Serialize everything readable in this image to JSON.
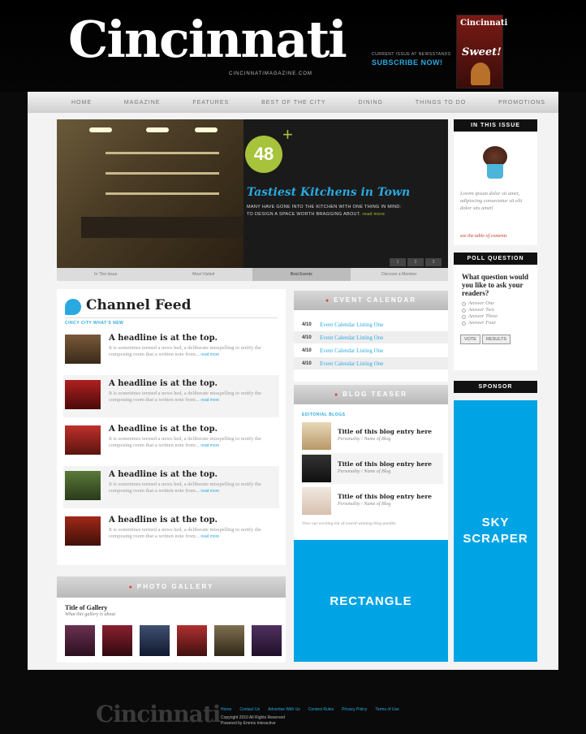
{
  "header": {
    "logo": "Cincinnati",
    "logo_sub": "CINCINNATIMAGAZINE.COM",
    "promo_small": "CURRENT ISSUE AT NEWSSTANDS",
    "promo_subscribe": "SUBSCRIBE NOW!",
    "cover_title": "Cincinnati",
    "cover_headline": "Sweet!"
  },
  "nav": [
    "HOME",
    "MAGAZINE",
    "FEATURES",
    "BEST OF THE CITY",
    "DINING",
    "THINGS TO DO",
    "PROMOTIONS"
  ],
  "hero": {
    "badge": "48",
    "plus": "+",
    "title": "Tastiest Kitchens in Town",
    "body": "MANY HAVE GONE INTO THE KITCHEN WITH ONE THING IN MIND: TO DESIGN A SPACE WORTH BRAGGING ABOUT.",
    "more": "read more",
    "pager": [
      "1",
      "2",
      "3"
    ],
    "tabs": [
      "In This Issue",
      "Most Visited",
      "Best Events",
      "Discover a Member"
    ]
  },
  "in_this_issue": {
    "heading": "IN THIS ISSUE",
    "text": "Lorem ipsum dolor sit amet, adipiscing consectetur sit elit dolor sits amet!",
    "link": "see the table of contents"
  },
  "poll": {
    "heading": "POLL QUESTION",
    "question": "What question would you like to ask your readers?",
    "options": [
      "Answer One",
      "Answer Two",
      "Answer Three",
      "Answer Four"
    ],
    "vote": "VOTE",
    "results": "RESULTS"
  },
  "sponsor": {
    "heading": "SPONSOR",
    "ad_line1": "SKY",
    "ad_line2": "SCRAPER"
  },
  "feed": {
    "title": "Channel Feed",
    "sub": "CINCY CITY WHAT'S NEW",
    "items": [
      {
        "headline": "A headline is at the top.",
        "text": "It is sometimes termed a news hed, a deliberate misspelling to notify the composing room that a written note from...",
        "more": "read more"
      },
      {
        "headline": "A headline is at the top.",
        "text": "It is sometimes termed a news hed, a deliberate misspelling to notify the composing room that a written note from...",
        "more": "read more"
      },
      {
        "headline": "A headline is at the top.",
        "text": "It is sometimes termed a news hed, a deliberate misspelling to notify the composing room that a written note from...",
        "more": "read more"
      },
      {
        "headline": "A headline is at the top.",
        "text": "It is sometimes termed a news hed, a deliberate misspelling to notify the composing room that a written note from...",
        "more": "read more"
      },
      {
        "headline": "A headline is at the top.",
        "text": "It is sometimes termed a news hed, a deliberate misspelling to notify the composing room that a written note from...",
        "more": "read more"
      }
    ]
  },
  "events": {
    "heading": "EVENT CALENDAR",
    "rows": [
      {
        "date": "4/10",
        "title": "Event Calendar Listing One"
      },
      {
        "date": "4/10",
        "title": "Event Calendar Listing One"
      },
      {
        "date": "4/10",
        "title": "Event Calendar Listing One"
      },
      {
        "date": "4/10",
        "title": "Event Calendar Listing One"
      }
    ]
  },
  "blog": {
    "heading": "BLOG TEASER",
    "sub": "EDITORIAL BLOGS",
    "items": [
      {
        "title": "Title of this blog entry here",
        "meta": "Personality / Name of Blog"
      },
      {
        "title": "Title of this blog entry here",
        "meta": "Personality / Name of Blog"
      },
      {
        "title": "Title of this blog entry here",
        "meta": "Personality / Name of Blog"
      }
    ],
    "footer": "View our exciting list of award-winning blog pundits"
  },
  "rectangle": {
    "label": "RECTANGLE"
  },
  "gallery": {
    "heading": "PHOTO GALLERY",
    "title": "Title of Gallery",
    "sub": "What this gallery is about"
  },
  "footer": {
    "logo": "Cincinnati",
    "links": [
      "Home",
      "Contact Us",
      "Advertise With Us",
      "Contest Rules",
      "Privacy Policy",
      "Terms of Use"
    ],
    "copyright": "Copyright 2010 All Rights Reserved",
    "powered": "Powered by Emmis Interactive"
  },
  "colors": {
    "accent": "#2aa9e0",
    "ad_blue": "#00a4e4",
    "badge_green": "#a7c23b",
    "alert_red": "#e24030"
  }
}
